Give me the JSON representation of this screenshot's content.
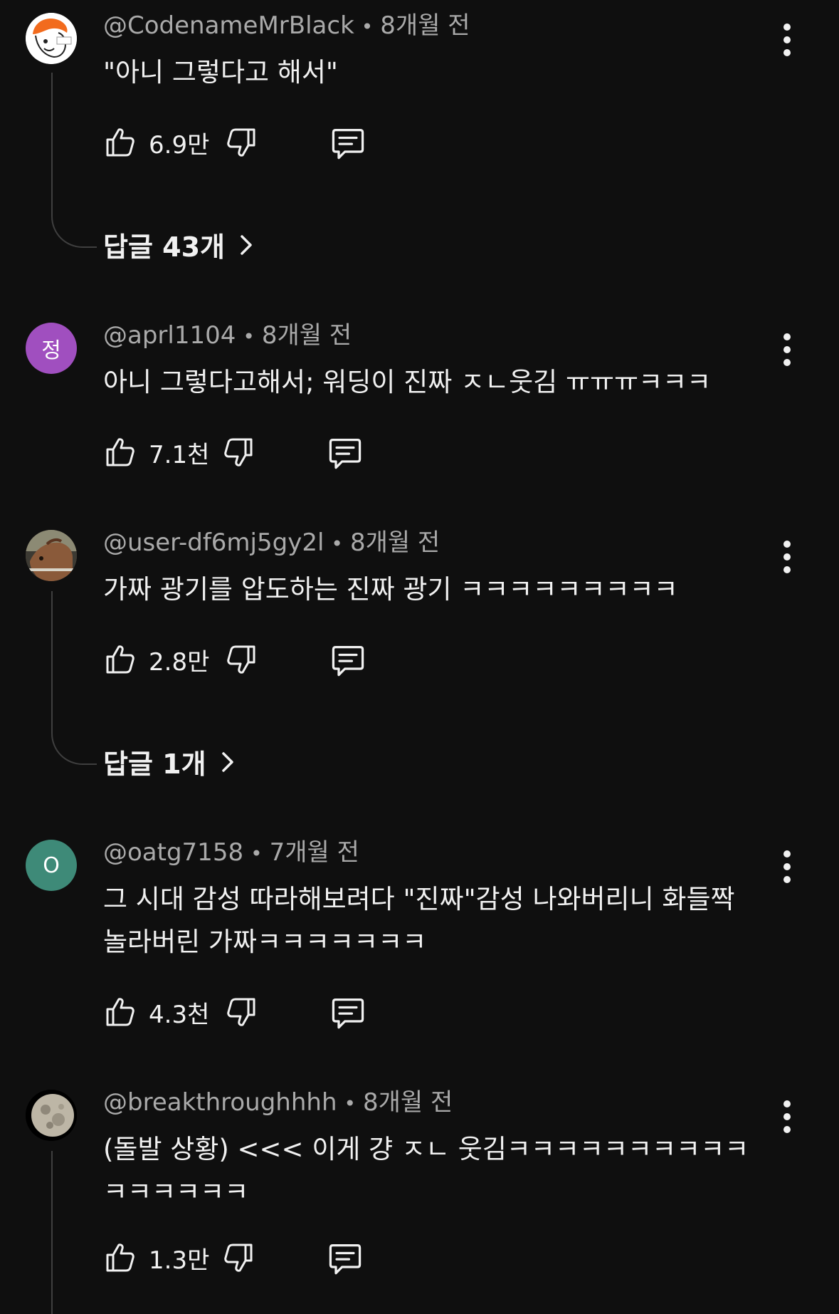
{
  "comments": [
    {
      "handle": "@CodenameMrBlack",
      "time": "8개월 전",
      "text": "\"아니 그렇다고 해서\"",
      "likes": "6.9만",
      "replies_label": "답글 43개",
      "avatar": {
        "type": "cartoon-face",
        "bg": "#ffffff",
        "accent": "#f26b1d"
      }
    },
    {
      "handle": "@aprl1104",
      "time": "8개월 전",
      "text": "아니 그렇다고해서; 워딩이 진짜 ㅈㄴ웃김 ㅠㅠㅠㅋㅋㅋ",
      "likes": "7.1천",
      "avatar": {
        "type": "letter",
        "letter": "정",
        "bg": "#a04fbf"
      }
    },
    {
      "handle": "@user-df6mj5gy2l",
      "time": "8개월 전",
      "text": "가짜 광기를 압도하는 진짜 광기 ㅋㅋㅋㅋㅋㅋㅋㅋㅋ",
      "likes": "2.8만",
      "replies_label": "답글 1개",
      "avatar": {
        "type": "photo-horse",
        "bg": "#6a4a35"
      }
    },
    {
      "handle": "@oatg7158",
      "time": "7개월 전",
      "text": "그 시대 감성 따라해보려다 \"진짜\"감성 나와버리니 화들짝\n놀라버린 가짜ㅋㅋㅋㅋㅋㅋㅋ",
      "likes": "4.3천",
      "avatar": {
        "type": "letter",
        "letter": "O",
        "bg": "#3e8a78"
      }
    },
    {
      "handle": "@breakthroughhhh",
      "time": "8개월 전",
      "text": "(돌발 상황) <<< 이게 걍 ㅈㄴ 웃김ㅋㅋㅋㅋㅋㅋㅋㅋㅋㅋ\nㅋㅋㅋㅋㅋㅋ",
      "likes": "1.3만",
      "avatar": {
        "type": "photo-moon",
        "bg": "#000000"
      }
    }
  ],
  "colors": {
    "background": "#0f0f0f",
    "text_primary": "#f1f1f1",
    "text_secondary": "#aaaaaa",
    "thread_line": "#3f3f3f"
  },
  "icons": {
    "like": "thumbs-up-icon",
    "dislike": "thumbs-down-icon",
    "reply": "comment-icon",
    "more": "more-vertical-icon",
    "expand": "chevron-right-icon"
  }
}
